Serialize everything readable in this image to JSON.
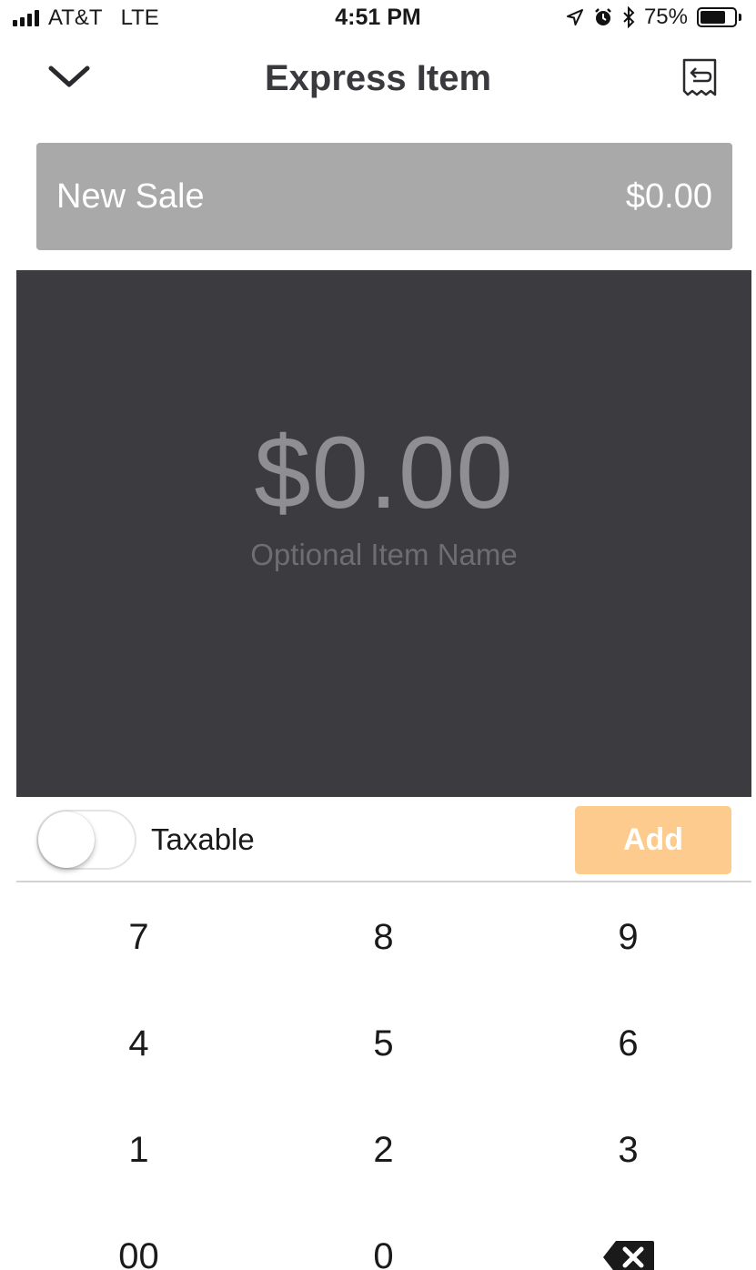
{
  "status_bar": {
    "carrier": "AT&T",
    "network": "LTE",
    "time": "4:51 PM",
    "battery_percent": "75%",
    "battery_level": 0.75,
    "icons": [
      "signal-icon",
      "location-arrow-icon",
      "alarm-icon",
      "bluetooth-icon",
      "battery-icon"
    ]
  },
  "nav": {
    "title": "Express Item",
    "left_icon": "chevron-down-icon",
    "right_icon": "receipt-return-icon"
  },
  "sale": {
    "label": "New Sale",
    "total": "$0.00"
  },
  "amount": {
    "value": "$0.00",
    "item_name_placeholder": "Optional Item Name",
    "item_name_value": ""
  },
  "tax_row": {
    "label": "Taxable",
    "toggle_on": false,
    "add_label": "Add"
  },
  "keypad": {
    "keys": [
      "7",
      "8",
      "9",
      "4",
      "5",
      "6",
      "1",
      "2",
      "3",
      "00",
      "0"
    ],
    "backspace_icon": "backspace-icon"
  },
  "colors": {
    "accent": "#fdcb8d",
    "panel": "#3b3b40",
    "sale_bar": "#a9a9a9",
    "title": "#3a3a3e"
  }
}
